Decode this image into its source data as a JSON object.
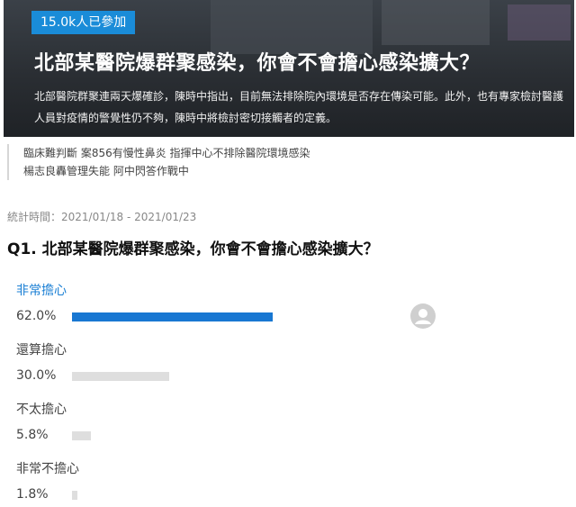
{
  "hero": {
    "participants": "15.0k人已參加",
    "title": "北部某醫院爆群聚感染，你會不會擔心感染擴大？",
    "description": "北部醫院群聚連兩天爆確診，陳時中指出，目前無法排除院內環境是否存在傳染可能。此外，也有專家檢討醫護人員對疫情的警覺性仍不夠，陳時中將檢討密切接觸者的定義。"
  },
  "related": [
    "臨床難判斷 案856有慢性鼻炎 指揮中心不排除醫院環境感染",
    "楊志良轟管理失能 阿中閃答作戰中"
  ],
  "stat_period": "統計時間：2021/01/18 - 2021/01/23",
  "question": "Q1. 北部某醫院爆群聚感染，你會不會擔心感染擴大？",
  "options": [
    {
      "label": "非常擔心",
      "percent_text": "62.0%",
      "value": 62.0,
      "selected": true
    },
    {
      "label": "還算擔心",
      "percent_text": "30.0%",
      "value": 30.0,
      "selected": false
    },
    {
      "label": "不太擔心",
      "percent_text": "5.8%",
      "value": 5.8,
      "selected": false
    },
    {
      "label": "非常不擔心",
      "percent_text": "1.8%",
      "value": 1.8,
      "selected": false
    }
  ],
  "colors": {
    "accent": "#1877d2",
    "badge": "#1a8cd8",
    "bar_inactive": "#dedede"
  },
  "icons": {
    "selected_marker": "avatar-icon"
  }
}
